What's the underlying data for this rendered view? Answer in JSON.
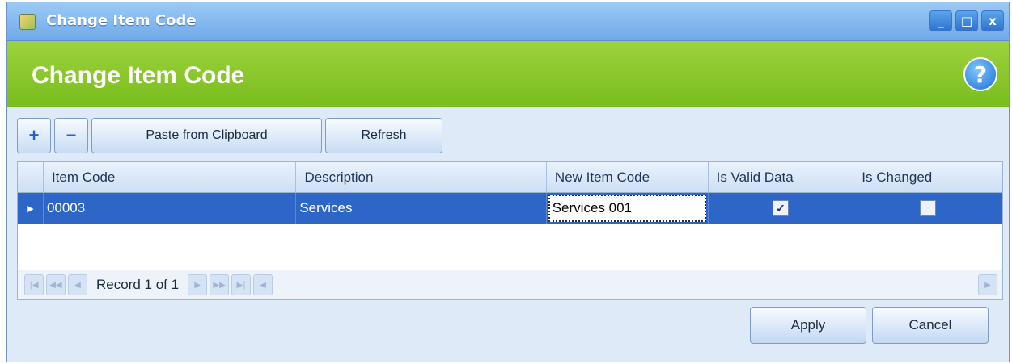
{
  "window": {
    "title": "Change Item Code",
    "controls": {
      "minimize": "_",
      "maximize": "□",
      "close": "x"
    }
  },
  "header": {
    "title": "Change Item Code",
    "help_glyph": "?"
  },
  "toolbar": {
    "add_glyph": "+",
    "remove_glyph": "−",
    "paste_label": "Paste from Clipboard",
    "refresh_label": "Refresh"
  },
  "grid": {
    "columns": [
      "Item Code",
      "Description",
      "New Item Code",
      "Is Valid Data",
      "Is Changed"
    ],
    "rows": [
      {
        "item_code": "00003",
        "description": "Services",
        "new_item_code": "Services 001",
        "is_valid_data": true,
        "is_changed": false
      }
    ]
  },
  "navigator": {
    "record_text": "Record 1 of 1"
  },
  "footer": {
    "apply_label": "Apply",
    "cancel_label": "Cancel"
  },
  "colors": {
    "header_green": "#8cc830",
    "selection_blue": "#2d66c7",
    "titlebar_blue": "#7fb6ee"
  }
}
